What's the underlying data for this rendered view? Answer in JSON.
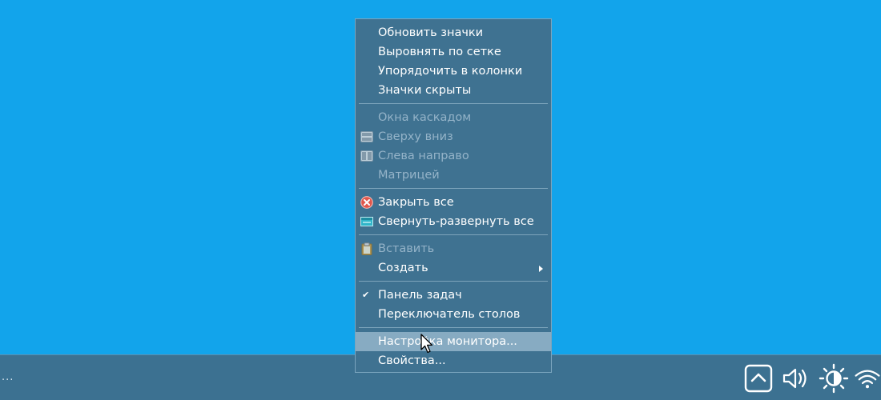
{
  "desktop": {
    "background_color": "#12a4eb"
  },
  "context_menu": {
    "groups": [
      [
        {
          "label": "Обновить значки",
          "enabled": true
        },
        {
          "label": "Выровнять по сетке",
          "enabled": true
        },
        {
          "label": "Упорядочить в колонки",
          "enabled": true
        },
        {
          "label": "Значки скрыты",
          "enabled": true
        }
      ],
      [
        {
          "label": "Окна каскадом",
          "enabled": false
        },
        {
          "label": "Сверху вниз",
          "enabled": false,
          "icon": "tile-horizontal-icon"
        },
        {
          "label": "Слева направо",
          "enabled": false,
          "icon": "tile-vertical-icon"
        },
        {
          "label": "Матрицей",
          "enabled": false
        }
      ],
      [
        {
          "label": "Закрыть все",
          "enabled": true,
          "icon": "close-all-icon"
        },
        {
          "label": "Свернуть-развернуть все",
          "enabled": true,
          "icon": "minimize-all-icon"
        }
      ],
      [
        {
          "label": "Вставить",
          "enabled": false,
          "icon": "paste-icon"
        },
        {
          "label": "Создать",
          "enabled": true,
          "submenu": true
        }
      ],
      [
        {
          "label": "Панель задач",
          "enabled": true,
          "checked": true
        },
        {
          "label": "Переключатель столов",
          "enabled": true
        }
      ],
      [
        {
          "label": "Настройка монитора...",
          "enabled": true,
          "highlighted": true
        },
        {
          "label": "Свойства...",
          "enabled": true
        }
      ]
    ]
  },
  "taskbar": {
    "left_text": "...",
    "tray_icons": [
      "show-hidden-icons-icon",
      "volume-icon",
      "brightness-icon",
      "wifi-icon"
    ]
  }
}
